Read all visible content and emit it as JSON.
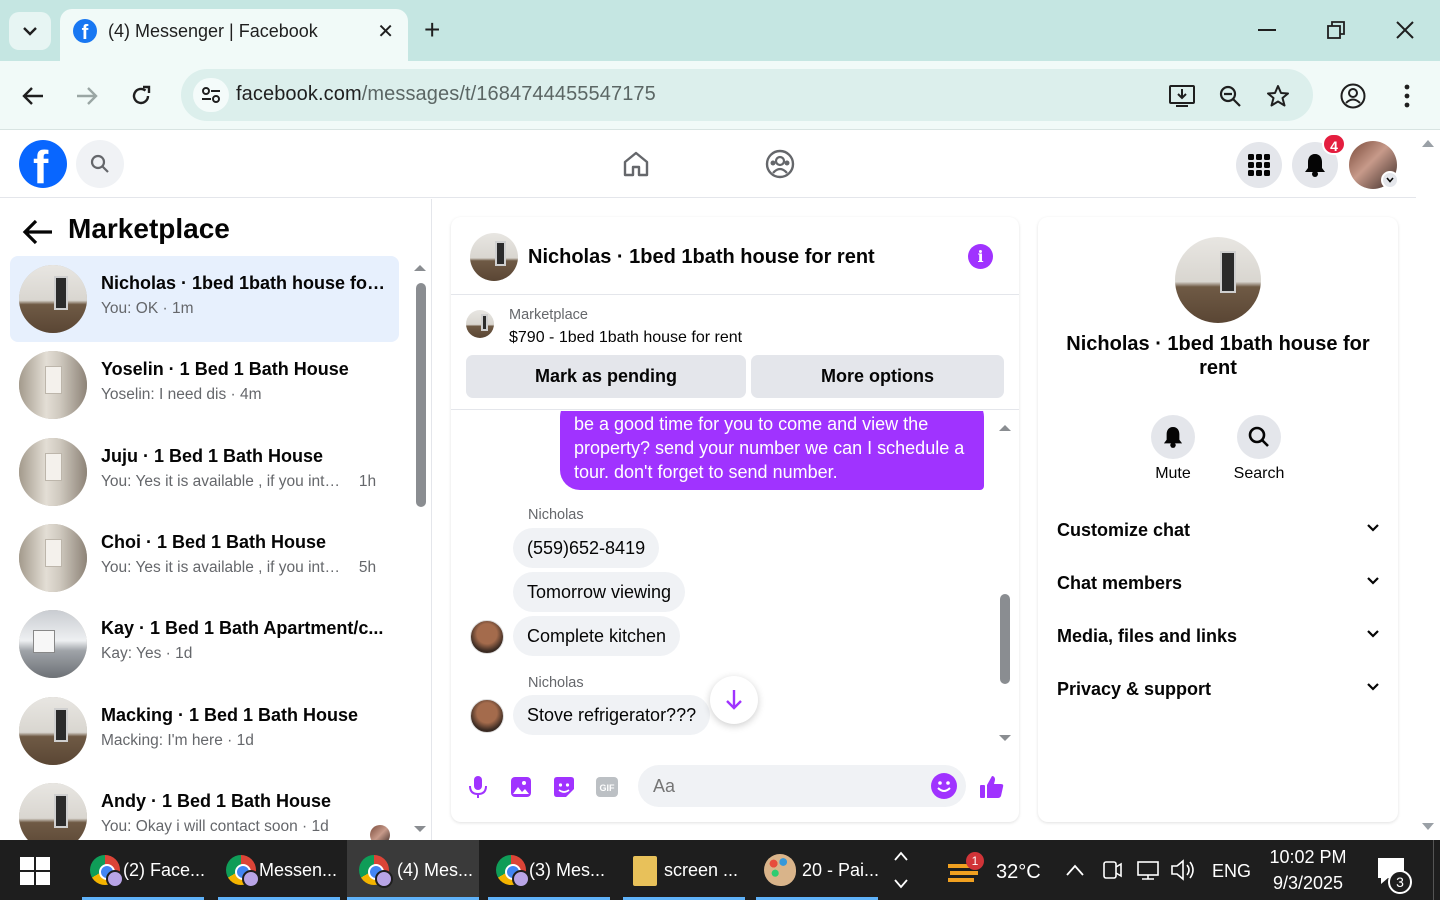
{
  "browser": {
    "tab_title": "(4) Messenger | Facebook",
    "url_host": "facebook.com",
    "url_path": "/messages/t/1684744455547175"
  },
  "header": {
    "notification_count": "4"
  },
  "sidebar": {
    "title": "Marketplace",
    "conversations": [
      {
        "name": "Nicholas · 1bed 1bath house for rent",
        "preview": "You: OK",
        "time": "1m",
        "thumb": "room"
      },
      {
        "name": "Yoselin · 1 Bed 1 Bath House",
        "preview": "Yoselin: I need dis",
        "time": "4m",
        "thumb": "room"
      },
      {
        "name": "Juju · 1 Bed 1 Bath House",
        "preview": "You: Yes it is available , if you inter...",
        "time": "1h",
        "thumb": "room"
      },
      {
        "name": "Choi · 1 Bed 1 Bath House",
        "preview": "You: Yes it is available , if you inter...",
        "time": "5h",
        "thumb": "room"
      },
      {
        "name": "Kay · 1 Bed 1 Bath Apartment/c...",
        "preview": "Kay: Yes",
        "time": "1d",
        "thumb": "kitchen"
      },
      {
        "name": "Macking · 1 Bed 1 Bath House",
        "preview": "Macking: I'm here",
        "time": "1d",
        "thumb": "room"
      },
      {
        "name": "Andy · 1 Bed 1 Bath House",
        "preview": "You: Okay i will contact soon",
        "time": "1d",
        "thumb": "room"
      }
    ]
  },
  "chat": {
    "title": "Nicholas · 1bed 1bath house for rent",
    "marketplace_label": "Marketplace",
    "listing": "$790 - 1bed 1bath house for rent",
    "mark_pending_label": "Mark as pending",
    "more_options_label": "More options",
    "outgoing_message": "be  a good time for you to come and view the property? send your number we can I schedule  a tour. don't forget to send  number.",
    "sender_name": "Nicholas",
    "incoming": [
      "(559)652-8419",
      "Tomorrow viewing",
      "Complete kitchen",
      "Stove refrigerator???"
    ],
    "input_placeholder": "Aa"
  },
  "details": {
    "title": "Nicholas · 1bed 1bath house for rent",
    "mute_label": "Mute",
    "search_label": "Search",
    "sections": [
      "Customize chat",
      "Chat members",
      "Media, files and links",
      "Privacy & support"
    ]
  },
  "taskbar": {
    "items": [
      "(2) Face...",
      "Messen...",
      "(4) Mes...",
      "(3) Mes...",
      "screen ...",
      "20 - Pai..."
    ],
    "weather_badge": "1",
    "temperature": "32°C",
    "language": "ENG",
    "time": "10:02 PM",
    "date": "9/3/2025",
    "notification_count": "3"
  },
  "colors": {
    "messenger_purple": "#a033ff",
    "facebook_blue": "#0866ff",
    "active_conversation": "#e7f0fd",
    "chrome_tabbar": "#c5e6e2"
  }
}
